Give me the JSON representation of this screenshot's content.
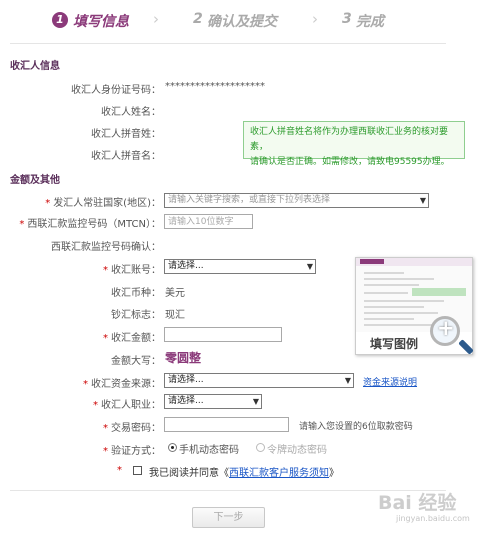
{
  "steps": [
    {
      "num": "1",
      "label": "填写信息"
    },
    {
      "num": "2",
      "label": "确认及提交"
    },
    {
      "num": "3",
      "label": "完成"
    }
  ],
  "chevron": "›",
  "payee_section": {
    "title": "收汇人信息",
    "id_label": "收汇人身份证号码：",
    "id_value": "********************",
    "name_label": "收汇人姓名：",
    "pinyin_surname_label": "收汇人拼音姓：",
    "pinyin_given_label": "收汇人拼音名：",
    "tip_line1": "收汇人拼音姓名将作为办理西联收汇业务的核对要素，",
    "tip_line2": "请确认是否正确。如需修改，请致电95595办理。"
  },
  "amount_section": {
    "title": "金额及其他",
    "required_mark": "*",
    "sender_country_label": "发汇人常驻国家(地区)：",
    "sender_country_placeholder": "请输入关键字搜索，或直接下拉列表选择",
    "mtcn_label": "西联汇款监控号码（MTCN）：",
    "mtcn_placeholder": "请输入10位数字",
    "mtcn_confirm_label": "西联汇款监控号码确认：",
    "account_label": "收汇账号：",
    "account_value": "请选择...",
    "currency_label": "收汇币种：",
    "currency_value": "美元",
    "cash_flag_label": "钞汇标志：",
    "cash_flag_value": "现汇",
    "amount_label": "收汇金额：",
    "amount_words_label": "金额大写：",
    "amount_words_value": "零圆整",
    "fund_source_label": "收汇资金来源：",
    "fund_source_value": "请选择...",
    "fund_source_link": "资金来源说明",
    "occupation_label": "收汇人职业：",
    "occupation_value": "请选择...",
    "password_label": "交易密码：",
    "password_hint": "请输入您设置的6位取款密码",
    "verify_label": "验证方式：",
    "verify_option1": "手机动态密码",
    "verify_option2": "令牌动态密码",
    "agree_text": "我已阅读并同意",
    "agree_quote_open": "《",
    "agree_link": "西联汇款客户服务须知",
    "agree_quote_close": "》"
  },
  "example_caption": "填写图例",
  "next_button": "下一步",
  "watermark": "Bai 经验",
  "watermark_sub": "jingyan.baidu.com",
  "colors": {
    "brand": "#8b3a7a",
    "tip_text": "#2b9a2b",
    "required": "#cc0000",
    "link": "#1a56c6"
  },
  "icons": [
    "chevron-right-icon",
    "dropdown-arrow-icon",
    "magnifier-icon",
    "radio-icon",
    "checkbox-icon"
  ]
}
